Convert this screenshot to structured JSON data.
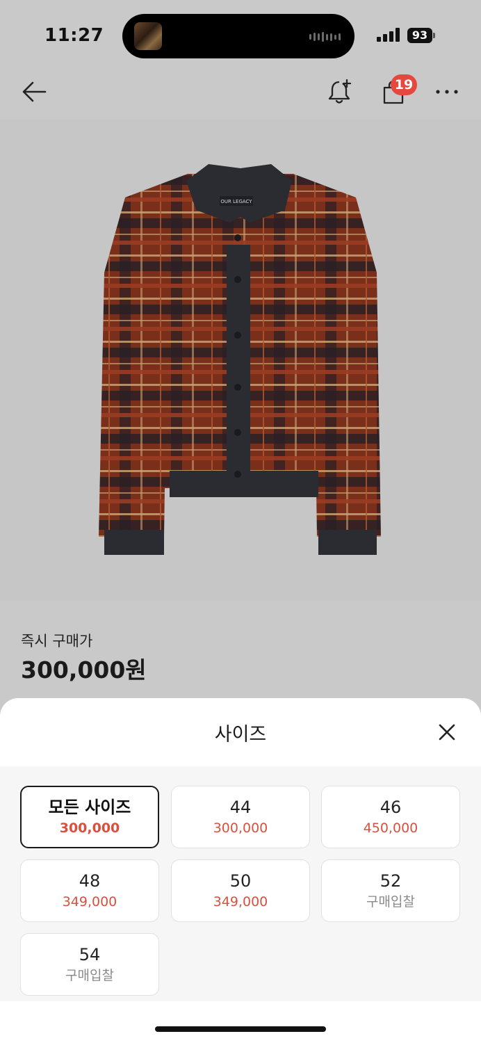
{
  "status_bar": {
    "time": "11:27",
    "battery": "93"
  },
  "nav": {
    "back_icon": "arrow-left-icon",
    "alert_icon": "bell-plus-icon",
    "bag_icon": "shopping-bag-icon",
    "cart_count": "19",
    "more_icon": "more-dots-icon"
  },
  "product": {
    "image_label": "OUR LEGACY",
    "price_label": "즉시 구매가",
    "price": "300,000원"
  },
  "size_sheet": {
    "title": "사이즈",
    "close_icon": "close-icon",
    "options": [
      {
        "size": "모든 사이즈",
        "price": "300,000",
        "selected": true
      },
      {
        "size": "44",
        "price": "300,000"
      },
      {
        "size": "46",
        "price": "450,000"
      },
      {
        "size": "48",
        "price": "349,000"
      },
      {
        "size": "50",
        "price": "349,000"
      },
      {
        "size": "52",
        "price": "구매입찰"
      },
      {
        "size": "54",
        "price": "구매입찰"
      }
    ]
  },
  "colors": {
    "accent": "#d9503f",
    "badge": "#e4483e",
    "muted": "#8a8a8a"
  }
}
